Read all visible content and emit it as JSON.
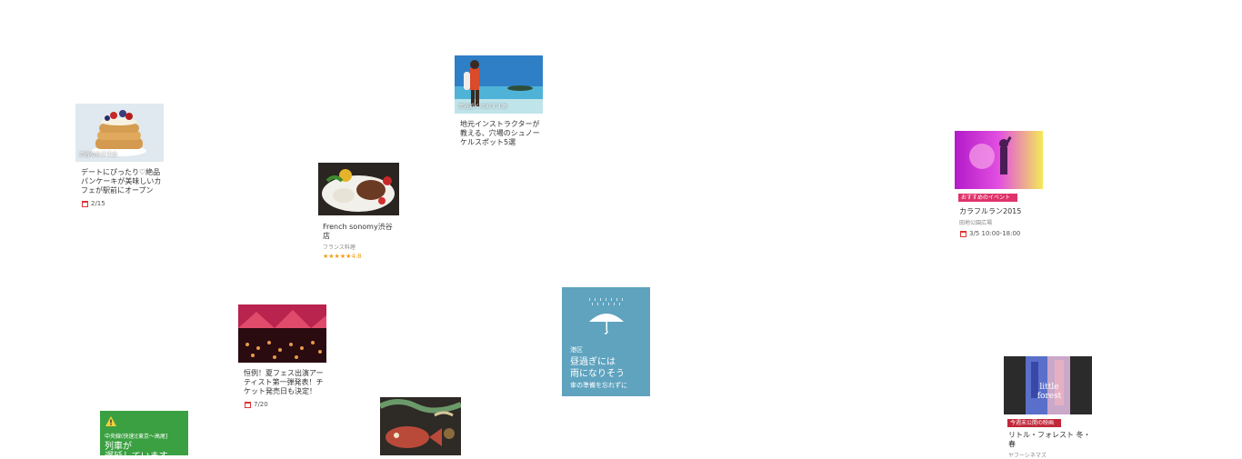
{
  "cards": {
    "pancake": {
      "overlay": "渋谷のおすすめ",
      "title": "デートにぴったり♡絶品パンケーキが美味しいカフェが駅前にオープン",
      "date": "2/15"
    },
    "snorkel": {
      "overlay": "渋谷近くのおすすめ",
      "title": "地元インストラクターが教える、穴場のシュノーケルスポット5選"
    },
    "french": {
      "title": "French sonomy渋谷店",
      "category": "フランス料理",
      "stars": "★★★★★",
      "rating": "4.8"
    },
    "colorrun": {
      "ribbon": "おすすめのイベント",
      "title": "カラフルラン2015",
      "venue": "田地公園広場",
      "date": "3/5  10:00-18:00"
    },
    "fes": {
      "title": "恒例！夏フェス出演アーティスト第一弾発表！チケット発売日も決定！",
      "date": "7/20"
    },
    "movie": {
      "ribbon": "今週末公開の映画",
      "title": "リトル・フォレスト 冬・春",
      "venue": "ヤフーシネマズ"
    }
  },
  "weather": {
    "area": "港区",
    "main": "昼過ぎには\n雨になりそう",
    "note": "傘の準備を忘れずに",
    "icon": "umbrella-icon",
    "color": "#5fa3bf"
  },
  "alert": {
    "line": "中央線(快速)[東京～高尾]",
    "main": "列車が\n遅延しています",
    "icon": "warning-icon",
    "color": "#3aa041"
  },
  "colors": {
    "eventRibbon": "#e0336b",
    "movieRibbon": "#c0283a"
  }
}
